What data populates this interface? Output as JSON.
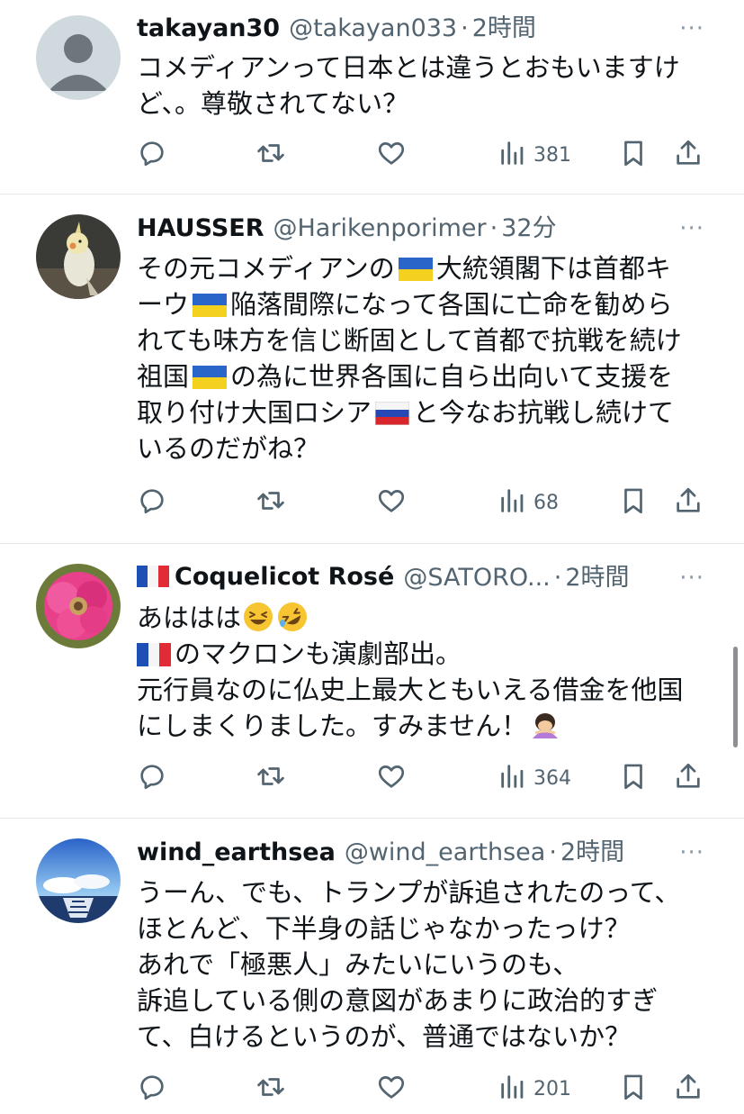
{
  "tweets": [
    {
      "name": "takayan30",
      "handle": "@takayan033",
      "sep": "·",
      "time": "2時間",
      "more": "···",
      "lines": [
        "コメディアンって日本とは違うとおもいますけ",
        "ど、。尊敬されてない？"
      ],
      "views": "381"
    },
    {
      "name": "HAUSSER",
      "handle": "@Harikenporimer",
      "sep": "·",
      "time": "32分",
      "more": "···",
      "lines": [
        {
          "a": "その元コメディアンの",
          "b": "大統領閣下は首都キ"
        },
        {
          "a": "ーウ",
          "b": "陥落間際になって各国に亡命を勧めら"
        },
        "れても味方を信じ断固として首都で抗戦を続け",
        {
          "a": "祖国",
          "b": "の為に世界各国に自ら出向いて支援を"
        },
        {
          "a": "取り付け大国ロシア",
          "b": "と今なお抗戦し続けて"
        },
        "いるのだがね？"
      ],
      "views": "68"
    },
    {
      "name": "Coquelicot Rosé",
      "handle": "@SATORO...",
      "sep": "·",
      "time": "2時間",
      "more": "···",
      "lines": [
        "あははは",
        "のマクロンも演劇部出。",
        "元行員なのに仏史上最大ともいえる借金を他国",
        "にしまくりました。すみません！"
      ],
      "views": "364"
    },
    {
      "name": "wind_earthsea",
      "handle": "@wind_earthsea",
      "sep": "·",
      "time": "2時間",
      "more": "···",
      "lines": [
        "うーん、でも、トランプが訴追されたのって、",
        "ほとんど、下半身の話じゃなかったっけ？",
        "あれで「極悪人」みたいにいうのも、",
        "訴追している側の意図があまりに政治的すぎ",
        "て、白けるというのが、普通ではないか？"
      ],
      "views": "201"
    }
  ],
  "icons": {
    "reply": "reply-icon",
    "retweet": "retweet-icon",
    "like": "heart-icon",
    "views": "views-icon",
    "bookmark": "bookmark-icon",
    "share": "share-icon"
  },
  "colors": {
    "text": "#0f1419",
    "secondary": "#536471",
    "icon": "#536471",
    "divider": "#e6e9ec"
  }
}
